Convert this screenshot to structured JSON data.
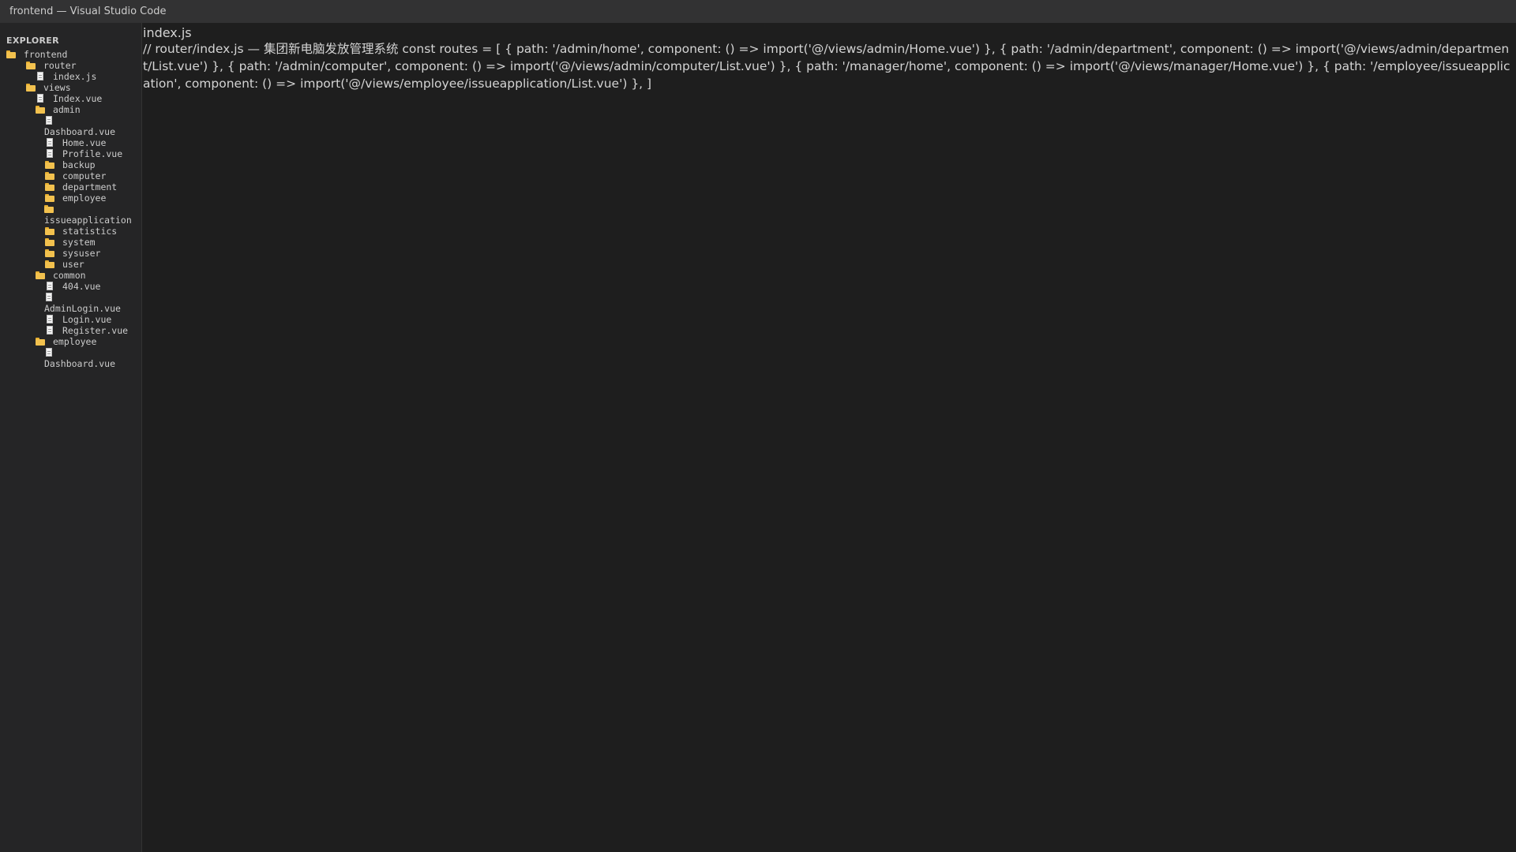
{
  "window": {
    "title": "frontend — Visual Studio Code"
  },
  "sidebar": {
    "header": "EXPLORER",
    "items": [
      {
        "label": "frontend",
        "type": "folder",
        "depth": 0
      },
      {
        "label": "router",
        "type": "folder",
        "depth": 1
      },
      {
        "label": "index.js",
        "type": "file",
        "depth": 2
      },
      {
        "label": "views",
        "type": "folder",
        "depth": 1
      },
      {
        "label": "Index.vue",
        "type": "file",
        "depth": 2
      },
      {
        "label": "admin",
        "type": "folder",
        "depth": 2
      },
      {
        "label": "Dashboard.vue",
        "type": "file",
        "depth": 3
      },
      {
        "label": "Home.vue",
        "type": "file",
        "depth": 3
      },
      {
        "label": "Profile.vue",
        "type": "file",
        "depth": 3
      },
      {
        "label": "backup",
        "type": "folder",
        "depth": 3
      },
      {
        "label": "computer",
        "type": "folder",
        "depth": 3
      },
      {
        "label": "department",
        "type": "folder",
        "depth": 3
      },
      {
        "label": "employee",
        "type": "folder",
        "depth": 3
      },
      {
        "label": "issueapplication",
        "type": "folder",
        "depth": 3
      },
      {
        "label": "statistics",
        "type": "folder",
        "depth": 3
      },
      {
        "label": "system",
        "type": "folder",
        "depth": 3
      },
      {
        "label": "sysuser",
        "type": "folder",
        "depth": 3
      },
      {
        "label": "user",
        "type": "folder",
        "depth": 3
      },
      {
        "label": "common",
        "type": "folder",
        "depth": 2
      },
      {
        "label": "404.vue",
        "type": "file",
        "depth": 3
      },
      {
        "label": "AdminLogin.vue",
        "type": "file",
        "depth": 3
      },
      {
        "label": "Login.vue",
        "type": "file",
        "depth": 3
      },
      {
        "label": "Register.vue",
        "type": "file",
        "depth": 3
      },
      {
        "label": "employee",
        "type": "folder",
        "depth": 2
      },
      {
        "label": "Dashboard.vue",
        "type": "file",
        "depth": 3
      }
    ]
  },
  "editor": {
    "tab": "index.js",
    "content": "// router/index.js — 集团新电脑发放管理系统 const routes = [ { path: '/admin/home', component: () => import('@/views/admin/Home.vue') }, { path: '/admin/department', component: () => import('@/views/admin/department/List.vue') }, { path: '/admin/computer', component: () => import('@/views/admin/computer/List.vue') }, { path: '/manager/home', component: () => import('@/views/manager/Home.vue') }, { path: '/employee/issueapplication', component: () => import('@/views/employee/issueapplication/List.vue') }, ]"
  }
}
